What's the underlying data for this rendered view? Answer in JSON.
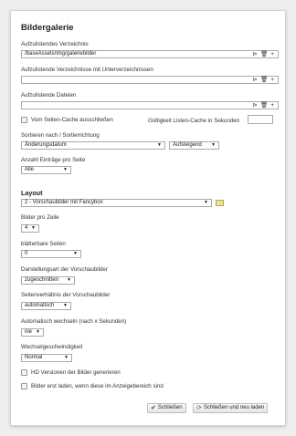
{
  "title": "Bildergalerie",
  "dir": {
    "label": "Aufzulistendes Verzeichnis",
    "value": "/baseAssets/img/galeriebilder"
  },
  "subdirs": {
    "label": "Aufzulistende Verzeichnisse mit Unterverzeichnissen",
    "value": ""
  },
  "files": {
    "label": "Aufzulistende Dateien",
    "value": ""
  },
  "field_icons": {
    "pick": "pointer-icon",
    "trash": "trash-icon",
    "add": "plus-icon",
    "pick_glyph": "⊳",
    "trash_glyph": "🗑",
    "add_glyph": "+"
  },
  "exclude_cache": {
    "label": "Vom Seiten-Cache ausschließen",
    "checked": false
  },
  "cache_validity": {
    "label": "Gültigkeit Listen-Cache in Sekunden",
    "value": ""
  },
  "sort": {
    "label": "Sortieren nach / Sortierrichtung",
    "field": "Änderungsdatum",
    "direction": "Aufsteigend"
  },
  "per_page": {
    "label": "Anzahl Einträge pro Seite",
    "value": "Alle"
  },
  "layout": {
    "heading": "Layout",
    "value": "2 - Vorschaubilder mit Fancybox"
  },
  "per_row": {
    "label": "Bilder pro Zeile",
    "value": "4"
  },
  "pages": {
    "label": "blätterbare Seiten",
    "value": "0"
  },
  "display": {
    "label": "Darstellungsart der Vorschaubilder",
    "value": "zugeschnitten"
  },
  "ratio": {
    "label": "Seitenverhältnis der Vorschaubilder",
    "value": "automatisch"
  },
  "autochange": {
    "label": "Automatisch wechseln (nach x Sekunden)",
    "value": "nie"
  },
  "speed": {
    "label": "Wechselgeschwindigkeit",
    "value": "Normal"
  },
  "hd": {
    "label": "HD Versionen der Bilder generieren",
    "checked": false
  },
  "lazy": {
    "label": "Bilder erst laden, wenn diese im Anzeigebereich sind",
    "checked": false
  },
  "buttons": {
    "close": "Schließen",
    "close_reload": "Schließen und neu laden"
  },
  "colors": {
    "accent_green": "#2f8f2f",
    "border": "#a9a9a9"
  }
}
